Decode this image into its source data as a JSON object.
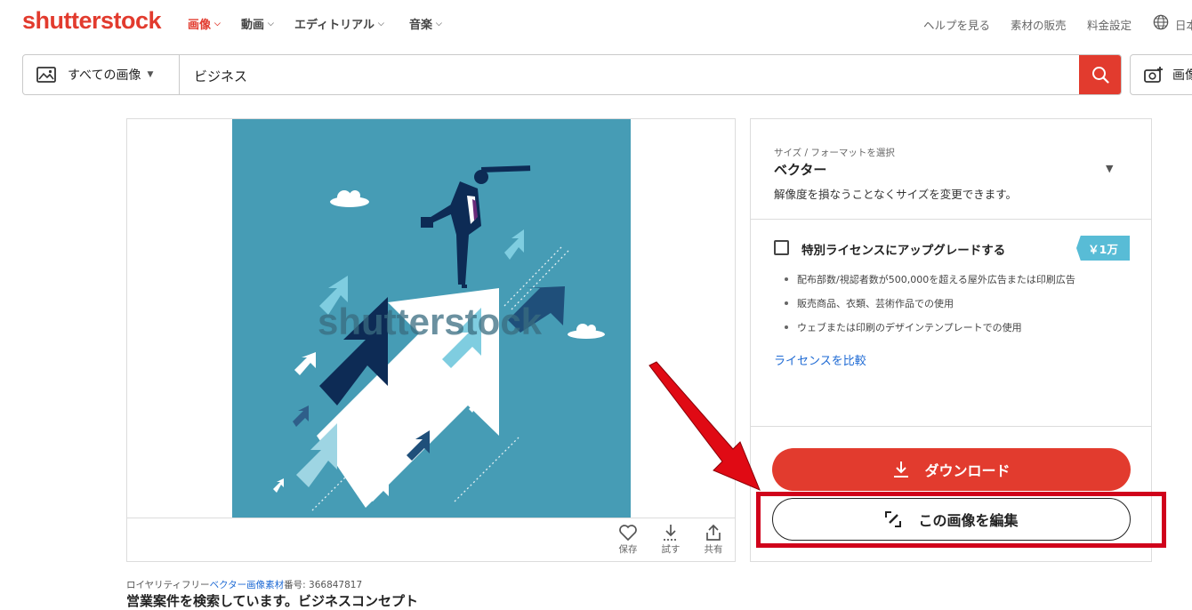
{
  "header": {
    "logo": "shutterstock",
    "nav": [
      {
        "label": "画像",
        "active": true
      },
      {
        "label": "動画",
        "active": false
      },
      {
        "label": "エディトリアル",
        "active": false
      },
      {
        "label": "音楽",
        "active": false
      }
    ],
    "links": [
      "ヘルプを見る",
      "素材の販売",
      "料金設定"
    ],
    "language": "日本"
  },
  "search": {
    "scope": "すべての画像",
    "query": "ビジネス",
    "reverse_search_label": "画像"
  },
  "image": {
    "watermark": "shutterstock",
    "actions": [
      "保存",
      "試す",
      "共有"
    ],
    "meta_prefix": "ロイヤリティフリー",
    "meta_link": "ベクター画像素材",
    "meta_number": "番号: 366847817",
    "title": "営業案件を検索しています。ビジネスコンセプト"
  },
  "license_panel": {
    "format_caption": "サイズ / フォーマットを選択",
    "format_value": "ベクター",
    "format_desc": "解像度を損なうことなくサイズを変更できます。",
    "upgrade_label": "特別ライセンスにアップグレードする",
    "upgrade_checked": false,
    "price_tag": "￥1万",
    "bullets": [
      "配布部数/視認者数が500,000を超える屋外広告または印刷広告",
      "販売商品、衣類、芸術作品での使用",
      "ウェブまたは印刷のデザインテンプレートでの使用"
    ],
    "compare_link": "ライセンスを比較",
    "download_label": "ダウンロード",
    "edit_label": "この画像を編集"
  },
  "colors": {
    "brand_red": "#e23b2e",
    "link_blue": "#1e6ad4",
    "image_bg": "#469cb5",
    "price_tag": "#58bcd6",
    "annotation_red": "#d0021b"
  }
}
